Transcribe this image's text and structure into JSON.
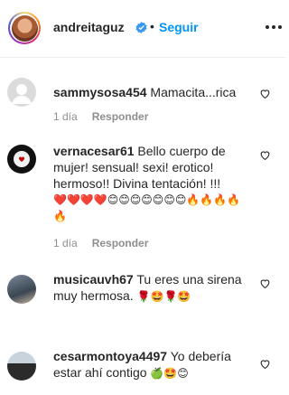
{
  "header": {
    "username": "andreitaguz",
    "separator": "•",
    "follow_label": "Seguir"
  },
  "comments": [
    {
      "username": "sammysosa454",
      "text": "Mamacita...rica",
      "time": "1 día",
      "reply_label": "Responder"
    },
    {
      "username": "vernacesar61",
      "text": "Bello cuerpo de mujer! sensual! sexi! erotico! hermoso!! Divina tentación! !!!",
      "emojis": "❤️❤️❤️❤️😊😊😊😊😊😊😊🔥🔥🔥🔥🔥",
      "time": "1 día",
      "reply_label": "Responder"
    },
    {
      "username": "musicauvh67",
      "text": "Tu eres una sirena muy hermosa.",
      "emojis": "🌹🤩🌹🤩",
      "time": "",
      "reply_label": ""
    },
    {
      "username": "cesarmontoya4497",
      "text": "Yo debería estar ahí contigo",
      "emojis": "🍏🤩😊",
      "time": "",
      "reply_label": ""
    }
  ],
  "colors": {
    "accent": "#0095f6",
    "text": "#262626",
    "muted": "#8e8e8e"
  }
}
